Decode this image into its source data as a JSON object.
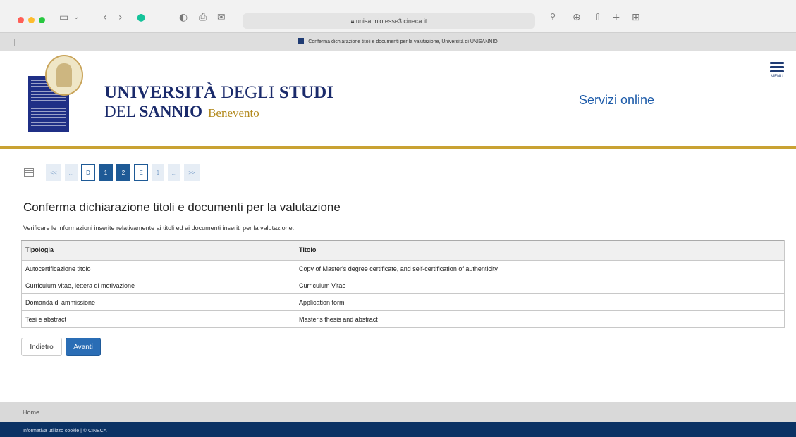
{
  "browser": {
    "url": "unisannio.esse3.cineca.it",
    "tab_title": "Conferma dichiarazione titoli e documenti per la valutazione, Università di UNISANNIO",
    "traffic_lights": [
      "#ff5f57",
      "#febc2e",
      "#28c840"
    ]
  },
  "header": {
    "university_line1_a": "UNIVERSITÀ",
    "university_line1_b": " DEGLI ",
    "university_line1_c": "STUDI",
    "university_line2_a": "DEL ",
    "university_line2_b": "SANNIO",
    "university_city": "Benevento",
    "services_link": "Servizi online",
    "menu_label": "MENU"
  },
  "wizard": {
    "steps": [
      "<<",
      "...",
      "D",
      "1",
      "2",
      "E",
      "1",
      "...",
      ">>"
    ]
  },
  "main": {
    "title": "Conferma dichiarazione titoli e documenti per la valutazione",
    "description": "Verificare le informazioni inserite relativamente ai titoli ed ai documenti inseriti per la valutazione.",
    "table": {
      "headers": [
        "Tipologia",
        "Titolo"
      ],
      "rows": [
        [
          "Autocertificazione titolo",
          "Copy of Master's degree certificate, and self-certification of authenticity"
        ],
        [
          "Curriculum vitae, lettera di motivazione",
          "Curriculum Vitae"
        ],
        [
          "Domanda di ammissione",
          "Application form"
        ],
        [
          "Tesi e abstract",
          "Master's thesis and abstract"
        ]
      ]
    },
    "back_button": "Indietro",
    "next_button": "Avanti"
  },
  "footer": {
    "home": "Home",
    "cookie": "Informativa utilizzo cookie | © CINECA"
  }
}
